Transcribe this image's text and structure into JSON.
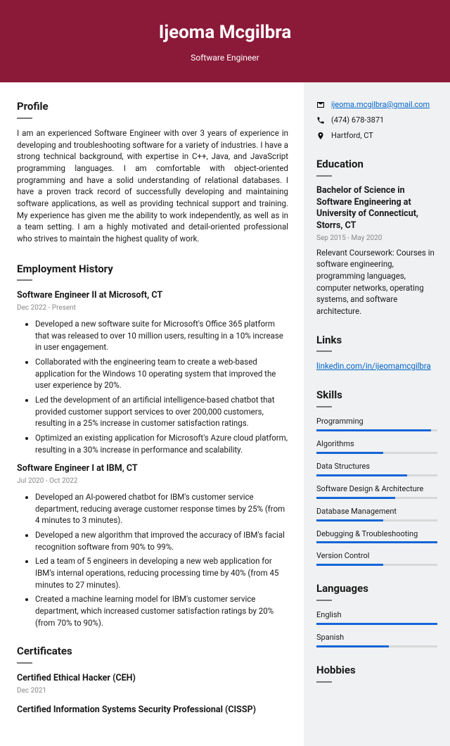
{
  "header": {
    "name": "Ijeoma Mcgilbra",
    "title": "Software Engineer"
  },
  "profile": {
    "heading": "Profile",
    "body": "I am an experienced Software Engineer with over 3 years of experience in developing and troubleshooting software for a variety of industries. I have a strong technical background, with expertise in C++, Java, and JavaScript programming languages. I am comfortable with object-oriented programming and have a solid understanding of relational databases. I have a proven track record of successfully developing and maintaining software applications, as well as providing technical support and training. My experience has given me the ability to work independently, as well as in a team setting. I am a highly motivated and detail-oriented professional who strives to maintain the highest quality of work."
  },
  "employment": {
    "heading": "Employment History",
    "jobs": [
      {
        "title": "Software Engineer II at Microsoft, CT",
        "dates": "Dec 2022 - Present",
        "bullets": [
          "Developed a new software suite for Microsoft's Office 365 platform that was released to over 10 million users, resulting in a 10% increase in user engagement.",
          "Collaborated with the engineering team to create a web-based application for the Windows 10 operating system that improved the user experience by 20%.",
          "Led the development of an artificial intelligence-based chatbot that provided customer support services to over 200,000 customers, resulting in a 25% increase in customer satisfaction ratings.",
          "Optimized an existing application for Microsoft's Azure cloud platform, resulting in a 30% increase in performance and scalability."
        ]
      },
      {
        "title": "Software Engineer I at IBM, CT",
        "dates": "Jul 2020 - Oct 2022",
        "bullets": [
          "Developed an AI-powered chatbot for IBM's customer service department, reducing average customer response times by 25% (from 4 minutes to 3 minutes).",
          "Developed a new algorithm that improved the accuracy of IBM's facial recognition software from 90% to 99%.",
          "Led a team of 5 engineers in developing a new web application for IBM's internal operations, reducing processing time by 40% (from 45 minutes to 27 minutes).",
          "Created a machine learning model for IBM's customer service department, which increased customer satisfaction ratings by 20% (from 70% to 90%)."
        ]
      }
    ]
  },
  "certificates": {
    "heading": "Certificates",
    "items": [
      {
        "title": "Certified Ethical Hacker (CEH)",
        "date": "Dec 2021"
      },
      {
        "title": "Certified Information Systems Security Professional (CISSP)"
      }
    ]
  },
  "contact": {
    "email": "ijeoma.mcgilbra@gmail.com",
    "phone": "(474) 678-3871",
    "location": "Hartford, CT"
  },
  "education": {
    "heading": "Education",
    "title": "Bachelor of Science in Software Engineering at University of Connecticut, Storrs, CT",
    "dates": "Sep 2015 - May 2020",
    "desc": "Relevant Coursework: Courses in software engineering, programming languages, computer networks, operating systems, and software architecture."
  },
  "links": {
    "heading": "Links",
    "url": "linkedin.com/in/ijeomamcgilbra"
  },
  "skills": {
    "heading": "Skills",
    "items": [
      {
        "name": "Programming",
        "pct": 95
      },
      {
        "name": "Algorithms",
        "pct": 55
      },
      {
        "name": "Data Structures",
        "pct": 75
      },
      {
        "name": "Software Design & Architecture",
        "pct": 65
      },
      {
        "name": "Database Management",
        "pct": 55
      },
      {
        "name": "Debugging & Troubleshooting",
        "pct": 100
      },
      {
        "name": "Version Control",
        "pct": 55
      }
    ]
  },
  "languages": {
    "heading": "Languages",
    "items": [
      {
        "name": "English",
        "pct": 100
      },
      {
        "name": "Spanish",
        "pct": 60
      }
    ]
  },
  "hobbies": {
    "heading": "Hobbies"
  }
}
